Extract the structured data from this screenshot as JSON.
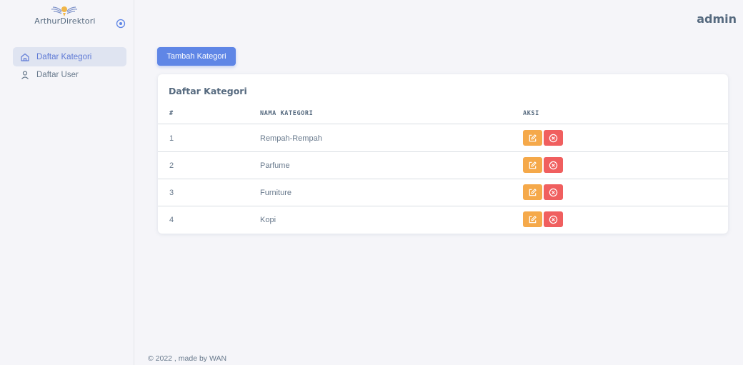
{
  "brand": {
    "name": "ArthurDirektori",
    "logo_icon": "laurel-crest-icon",
    "toggle_icon": "circle-dot-icon"
  },
  "sidebar": {
    "items": [
      {
        "label": "Daftar Kategori",
        "icon": "home-icon",
        "active": true
      },
      {
        "label": "Daftar User",
        "icon": "user-icon",
        "active": false
      }
    ]
  },
  "topbar": {
    "username": "admin"
  },
  "main": {
    "add_button_label": "Tambah Kategori",
    "card_title": "Daftar Kategori",
    "table": {
      "headers": [
        "#",
        "NAMA KATEGORI",
        "AKSI"
      ],
      "rows": [
        {
          "no": "1",
          "name": "Rempah-Rempah"
        },
        {
          "no": "2",
          "name": "Parfume"
        },
        {
          "no": "3",
          "name": "Furniture"
        },
        {
          "no": "4",
          "name": "Kopi"
        }
      ]
    }
  },
  "colors": {
    "primary": "#5f86e6",
    "edit": "#f5a94a",
    "delete": "#f05f5f"
  },
  "footer": {
    "text": "© 2022 , made by WAN"
  }
}
